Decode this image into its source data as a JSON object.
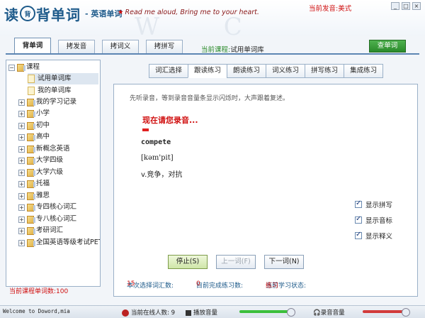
{
  "header": {
    "logo_char1": "读",
    "logo_badge": "背",
    "logo_rest": "背单词",
    "logo_sub": "- 英语单词",
    "slogan": "Read me aloud, Bring me to your heart.",
    "current_voice": "当前发音:美式",
    "window_buttons": [
      "_",
      "□",
      "×"
    ]
  },
  "main_tabs": [
    "背单词",
    "拷发音",
    "拷词义",
    "拷拼写"
  ],
  "current_course_label": "当前课程:",
  "current_course_value": "试用单词库",
  "lookup_button": "查单词",
  "tree": {
    "root": "课程",
    "items": [
      "试用单词库",
      "我的单词库",
      "我的学习记录",
      "小学",
      "初中",
      "高中",
      "新概念英语",
      "大学四级",
      "大学六级",
      "托福",
      "雅思",
      "专四核心词汇",
      "专八核心词汇",
      "考研词汇",
      "全国英语等级考试PETS"
    ],
    "footer": "当前课程单词数:100"
  },
  "sub_tabs": [
    "词汇选择",
    "跟读练习",
    "朗读练习",
    "词义练习",
    "拼写练习",
    "集成练习"
  ],
  "practice": {
    "instruction": "先听录音，等到录音音量条显示闪烁时，大声跟着复述。",
    "record_now": "现在请您录音...",
    "word": "compete",
    "phonetic": "[kəm'pit]",
    "meaning": "v.竞争，对抗",
    "checks": [
      "显示拼写",
      "显示音标",
      "显示释义"
    ],
    "buttons": {
      "stop": "停止(S)",
      "prev": "上一词(F)",
      "next": "下一词(N)"
    },
    "stats": {
      "selected_label": "本次选择词汇数:",
      "selected_value": "15",
      "done_label": "目前完成练习数:",
      "done_value": "0",
      "state_label": "当前学习状态:",
      "state_value": "练习"
    }
  },
  "statusbar": {
    "welcome": "Welcome to Doword,mia",
    "online": "当前在线人数: 9",
    "playback_volume": "播放音量",
    "record_volume": "录音音量"
  }
}
